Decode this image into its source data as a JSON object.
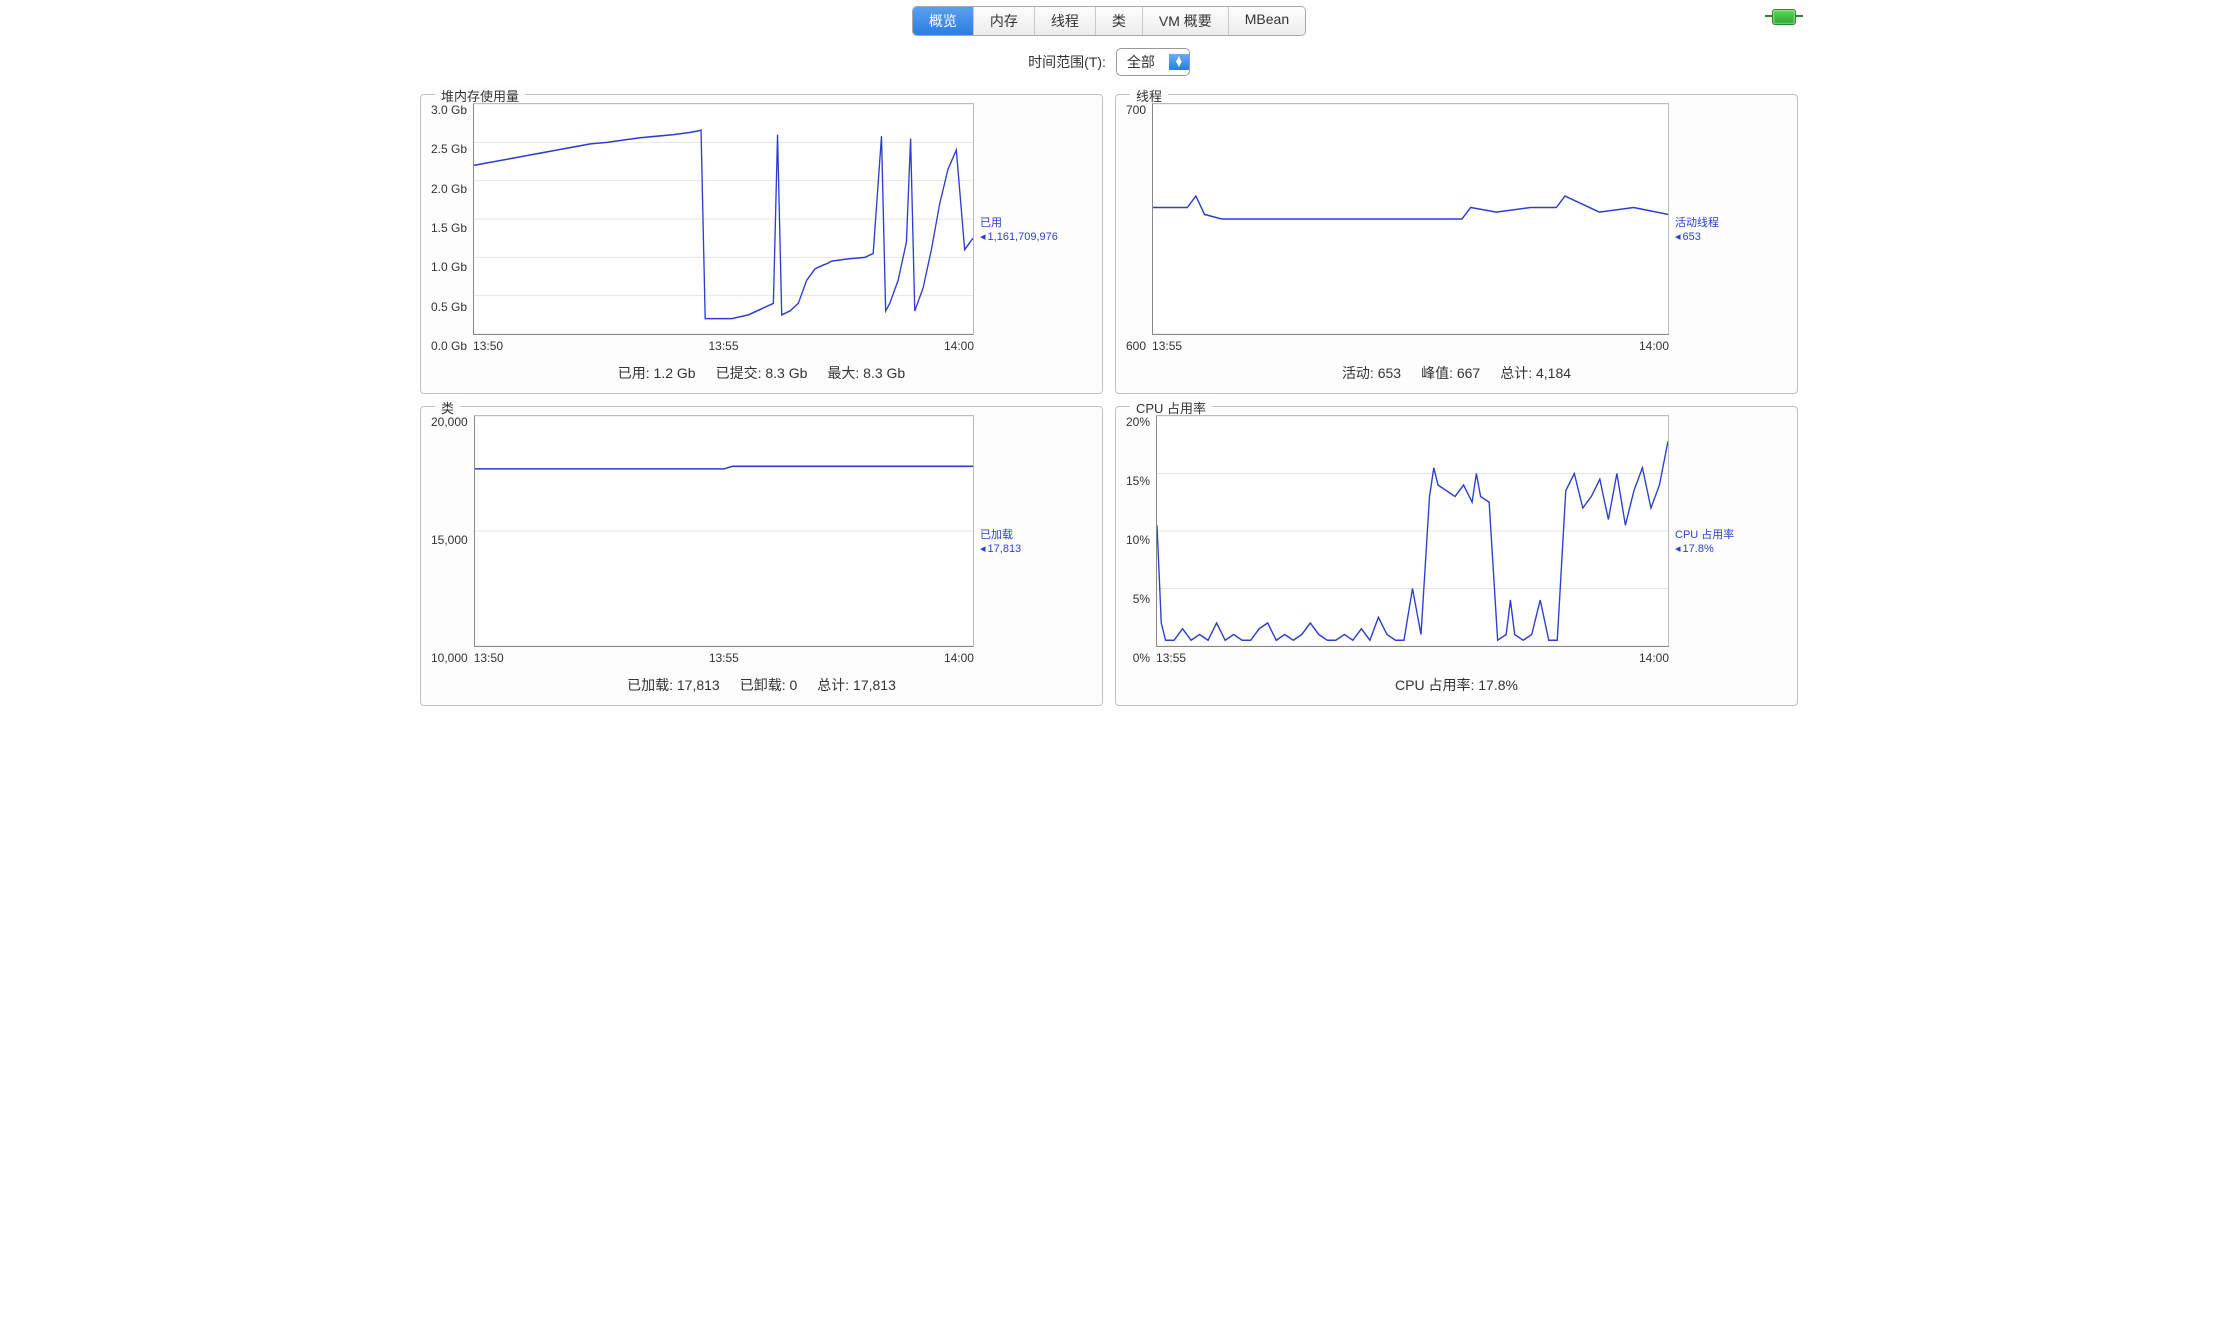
{
  "tabs": [
    "概览",
    "内存",
    "线程",
    "类",
    "VM 概要",
    "MBean"
  ],
  "selected_tab_index": 0,
  "time_range": {
    "label": "时间范围(T):",
    "value": "全部"
  },
  "panels": {
    "heap": {
      "title": "堆内存使用量",
      "legend_name": "已用",
      "legend_value": "1,161,709,976",
      "footer": [
        [
          "已用",
          "1.2 Gb"
        ],
        [
          "已提交",
          "8.3 Gb"
        ],
        [
          "最大",
          "8.3 Gb"
        ]
      ]
    },
    "threads": {
      "title": "线程",
      "legend_name": "活动线程",
      "legend_value": "653",
      "footer": [
        [
          "活动",
          "653"
        ],
        [
          "峰值",
          "667"
        ],
        [
          "总计",
          "4,184"
        ]
      ]
    },
    "classes": {
      "title": "类",
      "legend_name": "已加载",
      "legend_value": "17,813",
      "footer": [
        [
          "已加载",
          "17,813"
        ],
        [
          "已卸载",
          "0"
        ],
        [
          "总计",
          "17,813"
        ]
      ]
    },
    "cpu": {
      "title": "CPU 占用率",
      "legend_name": "CPU 占用率",
      "legend_value": "17.8%",
      "footer": [
        [
          "CPU 占用率",
          "17.8%"
        ]
      ]
    }
  },
  "chart_data": [
    {
      "id": "heap",
      "type": "line",
      "title": "堆内存使用量",
      "ylabel": "Gb",
      "ylim": [
        0,
        3
      ],
      "y_ticks": [
        "3.0 Gb",
        "2.5 Gb",
        "2.0 Gb",
        "1.5 Gb",
        "1.0 Gb",
        "0.5 Gb",
        "0.0 Gb"
      ],
      "x_ticks": [
        "13:50",
        "13:55",
        "14:00"
      ],
      "x": [
        0,
        2,
        4,
        6,
        8,
        10,
        12,
        14,
        16,
        18,
        20,
        22,
        24,
        26,
        27,
        27.3,
        27.8,
        29,
        31,
        33,
        35,
        36,
        36.5,
        37,
        38,
        39,
        40,
        41,
        42,
        42.5,
        43,
        45,
        47,
        48,
        49,
        49.5,
        50,
        51,
        52,
        52.5,
        53,
        54,
        55,
        56,
        57,
        58,
        59,
        60
      ],
      "y": [
        2.2,
        2.24,
        2.28,
        2.32,
        2.36,
        2.4,
        2.44,
        2.48,
        2.5,
        2.53,
        2.56,
        2.58,
        2.6,
        2.63,
        2.65,
        2.66,
        0.2,
        0.2,
        0.2,
        0.25,
        0.35,
        0.4,
        2.6,
        0.25,
        0.3,
        0.4,
        0.7,
        0.85,
        0.9,
        0.92,
        0.95,
        0.98,
        1.0,
        1.05,
        2.58,
        0.3,
        0.4,
        0.7,
        1.2,
        2.55,
        0.3,
        0.6,
        1.1,
        1.7,
        2.15,
        2.4,
        1.1,
        1.25
      ],
      "series": [
        {
          "name": "已用",
          "current": 1161709976
        }
      ]
    },
    {
      "id": "threads",
      "type": "line",
      "title": "线程",
      "ylim": [
        600,
        700
      ],
      "y_ticks": [
        "700",
        "600"
      ],
      "x_ticks": [
        "13:55",
        "14:00"
      ],
      "x": [
        0,
        4,
        5,
        6,
        8,
        12,
        16,
        20,
        24,
        28,
        32,
        36,
        37,
        40,
        44,
        47,
        48,
        52,
        56,
        60
      ],
      "y": [
        655,
        655,
        660,
        652,
        650,
        650,
        650,
        650,
        650,
        650,
        650,
        650,
        655,
        653,
        655,
        655,
        660,
        653,
        655,
        652
      ],
      "series": [
        {
          "name": "活动线程",
          "current": 653
        }
      ]
    },
    {
      "id": "classes",
      "type": "line",
      "title": "类",
      "ylim": [
        10000,
        20000
      ],
      "y_ticks": [
        "20,000",
        "15,000",
        "10,000"
      ],
      "x_ticks": [
        "13:50",
        "13:55",
        "14:00"
      ],
      "x": [
        0,
        30,
        31,
        60
      ],
      "y": [
        17700,
        17700,
        17813,
        17813
      ],
      "series": [
        {
          "name": "已加载",
          "current": 17813
        }
      ]
    },
    {
      "id": "cpu",
      "type": "line",
      "title": "CPU 占用率",
      "ylabel": "%",
      "ylim": [
        0,
        20
      ],
      "y_ticks": [
        "20%",
        "15%",
        "10%",
        "5%",
        "0%"
      ],
      "x_ticks": [
        "13:55",
        "14:00"
      ],
      "x": [
        0,
        0.5,
        1,
        2,
        3,
        4,
        5,
        6,
        7,
        8,
        9,
        10,
        11,
        12,
        13,
        14,
        15,
        16,
        17,
        18,
        19,
        20,
        21,
        22,
        23,
        24,
        25,
        26,
        27,
        28,
        29,
        30,
        31,
        32,
        32.5,
        33,
        34,
        35,
        36,
        37,
        37.5,
        38,
        39,
        40,
        41,
        41.5,
        42,
        43,
        44,
        45,
        46,
        47,
        48,
        49,
        50,
        51,
        52,
        53,
        54,
        55,
        56,
        57,
        58,
        59,
        60
      ],
      "y": [
        10.5,
        2.0,
        0.5,
        0.5,
        1.5,
        0.5,
        1.0,
        0.5,
        2.0,
        0.5,
        1.0,
        0.5,
        0.5,
        1.5,
        2.0,
        0.5,
        1.0,
        0.5,
        1.0,
        2.0,
        1.0,
        0.5,
        0.5,
        1.0,
        0.5,
        1.5,
        0.5,
        2.5,
        1.0,
        0.5,
        0.5,
        5.0,
        1.0,
        13.0,
        15.5,
        14.0,
        13.5,
        13.0,
        14.0,
        12.5,
        15.0,
        13.0,
        12.5,
        0.5,
        1.0,
        4.0,
        1.0,
        0.5,
        1.0,
        4.0,
        0.5,
        0.5,
        13.5,
        15.0,
        12.0,
        13.0,
        14.5,
        11.0,
        15.0,
        10.5,
        13.5,
        15.5,
        12.0,
        14.0,
        17.8
      ],
      "series": [
        {
          "name": "CPU 占用率",
          "current": "17.8%"
        }
      ]
    }
  ]
}
